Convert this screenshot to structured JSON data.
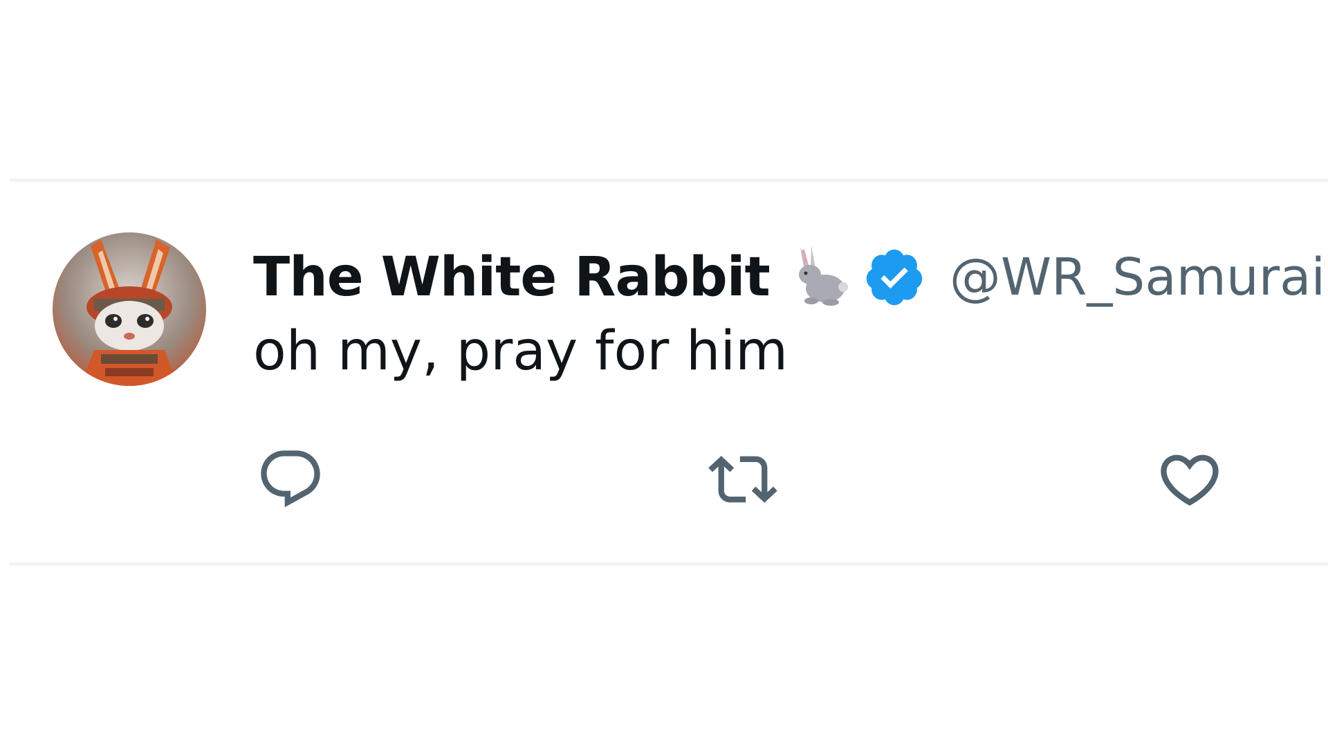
{
  "tweet": {
    "display_name": "The White Rabbit",
    "name_emoji": "rabbit-emoji",
    "verified": true,
    "handle": "@WR_Samurai",
    "separator": "·",
    "text": "oh my, pray for him",
    "avatar": "samurai-rabbit-avatar"
  },
  "actions": [
    {
      "name": "reply",
      "icon": "reply-icon"
    },
    {
      "name": "retweet",
      "icon": "retweet-icon"
    },
    {
      "name": "like",
      "icon": "heart-icon"
    }
  ],
  "colors": {
    "text": "#0f1419",
    "secondary": "#536471",
    "verified": "#1d9bf0",
    "divider": "#eff3f4"
  }
}
